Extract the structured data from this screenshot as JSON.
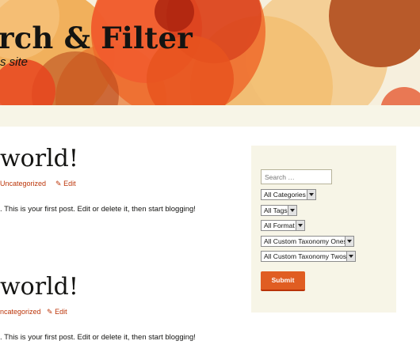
{
  "header": {
    "site_title": "rch & Filter",
    "site_description": "s site"
  },
  "posts": [
    {
      "title": "world!",
      "category_prefix": "",
      "category": "Uncategorized",
      "edit_label": "Edit",
      "excerpt": ". This is your first post. Edit or delete it, then start blogging!"
    },
    {
      "title": "world!",
      "category_prefix": "",
      "category": "ncategorized",
      "edit_label": "Edit",
      "excerpt": ". This is your first post. Edit or delete it, then start blogging!"
    }
  ],
  "sidebar": {
    "search_placeholder": "Search …",
    "selects": [
      "All Categories",
      "All Tags",
      "All Format",
      "All Custom Taxonomy Ones",
      "All Custom Taxonomy Twos"
    ],
    "submit_label": "Submit"
  },
  "colors": {
    "accent": "#bc360a",
    "button": "#e05d22",
    "sidebar_bg": "#f7f5e7"
  }
}
